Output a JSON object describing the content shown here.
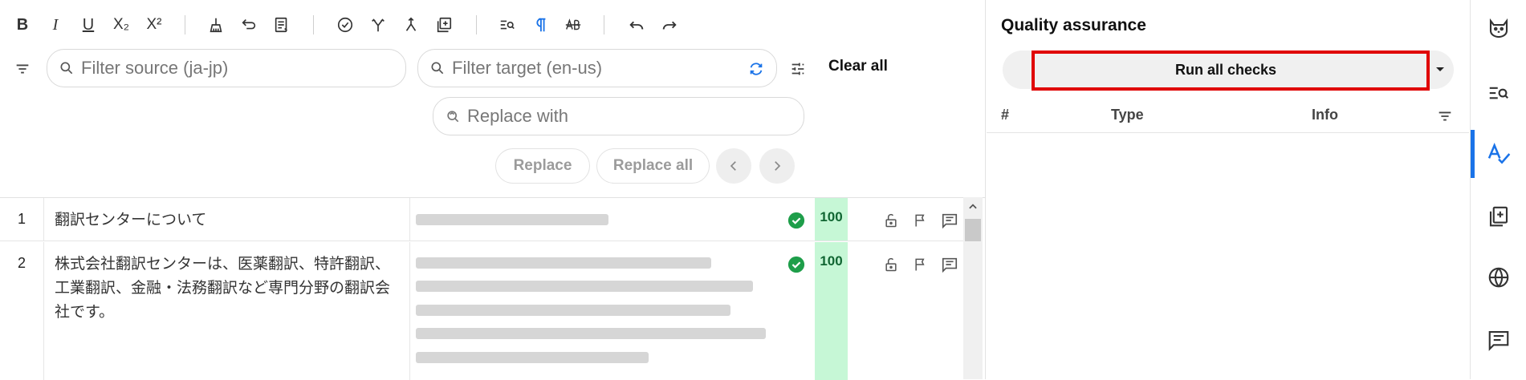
{
  "toolbar": {
    "buttons": [
      "bold",
      "italic",
      "underline",
      "subscript",
      "superscript",
      "clear-format",
      "insert-tag",
      "insert-special",
      "confirm",
      "split",
      "merge",
      "add",
      "find",
      "show-formatting",
      "spellcheck",
      "undo",
      "redo"
    ],
    "bold_label": "B",
    "italic_label": "I",
    "underline_label": "U",
    "subscript_label": "X₂",
    "superscript_label": "X²"
  },
  "filters": {
    "source_placeholder": "Filter source (ja-jp)",
    "target_placeholder": "Filter target (en-us)",
    "replace_placeholder": "Replace with",
    "clear_all": "Clear all",
    "replace": "Replace",
    "replace_all": "Replace all"
  },
  "segments": [
    {
      "num": "1",
      "source": "翻訳センターについて",
      "status": "confirmed",
      "match": "100"
    },
    {
      "num": "2",
      "source": "株式会社翻訳センターは、医薬翻訳、特許翻訳、工業翻訳、金融・法務翻訳など専門分野の翻訳会社です。",
      "status": "confirmed",
      "match": "100"
    }
  ],
  "qa": {
    "title": "Quality assurance",
    "run_label": "Run all checks",
    "columns": {
      "num": "#",
      "type": "Type",
      "info": "Info"
    }
  },
  "rail": {
    "items": [
      "cat-icon",
      "search-list-icon",
      "spellcheck-icon",
      "add-note-icon",
      "globe-icon",
      "comment-icon"
    ],
    "active": "spellcheck-icon"
  },
  "colors": {
    "accent": "#1a73e8",
    "match_bg": "#c6f7d6",
    "confirm_green": "#1e9e4a",
    "highlight": "#e00000"
  }
}
